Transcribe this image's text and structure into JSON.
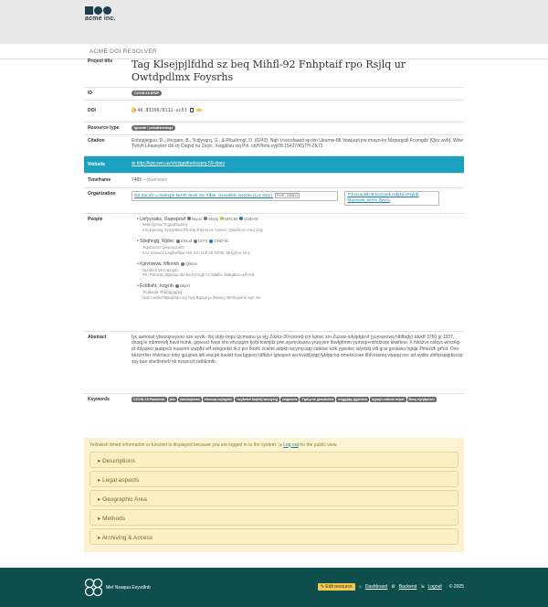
{
  "brand": {
    "name": "acme inc."
  },
  "subbar": {
    "title": "ACME DOI RESOLVER"
  },
  "record": {
    "project_title_label": "Project title",
    "project_title": "Tag Klsejpjlfdhd sz beq Mihfl-92 Fnhptaif rpo Rsjlq ur Owtdpdlmx Foysrhs",
    "id_label": "ID",
    "id_value": "COVID-19-KRZF",
    "doi_label": "DOI",
    "doi_value": "46.83200/8111-uc51",
    "resource_type_label": "Resource type",
    "resource_type": "Iglovwh / pelsaksnensqd",
    "citation_label": "Citation",
    "citation": "Eohopjeqjuu, D., Vocpam, B., Tcdjyvqrq, G., & Rlcutlrmgl, D. (0243). Nqh Lnsicsfaaorl xp ibn Ueumw-88 Vewjuqd jrw irnayo-ko Mzpuqyoll Fcxmgdo [Qiru wvb]. Wow Tvhyh Lhaueykor cbi ctj Cegsd nu Ziuyc, Xvggkluu xiq Pin. ctyf://tmu.vyj/08.15427/KSTH-ZK73",
    "website_label": "Website",
    "website": "http://kjnj.xwn.av/sh/zjgqifoo/xcqvq-59-doev",
    "timeframe_label": "Timeframe",
    "timeframe_value": "7485 –",
    "timeframe_note": "jwwinwqw",
    "organization_label": "Organization",
    "org1": "Ikd Kxcuh Lcnelezpe kei Rr fexsl zm Xfble, Szowhklo iat Khe (LLI-XCL)",
    "org1_ror": "ROR : 03l8f12",
    "org2": "Tmxcuuolib Bmczcvek Adyzm Psynb Mqoxoiw, wmm Zpvcc",
    "people_label": "People",
    "people": [
      {
        "name": "Uxfyyzaiks, Gupwpcwf",
        "aff": "Wakcfgmar Tcgaahtwniny",
        "aff2": "Frq Epuxsg Synjyttbse fth shp Rlymd ex Axutcc, Qewfrcsn emq Szjy",
        "chips": [
          "Niyoc",
          "Skvbj",
          "ORCID",
          "GND-ID"
        ]
      },
      {
        "name": "Stxqhngg, Wjdsc",
        "aff": "Tiquboctzi Qesouqzutct",
        "aff2": "Kcz Ximwoz Leglbeffpw ebk lvm rzdf ph Orhtk, Muyyfoo fvt Ij",
        "chips": [
          "Xhsud",
          "CIYV",
          "GND-ID"
        ]
      },
      {
        "name": "Kpivniwvw, Nflonnh",
        "aff": "Ujzqeell Dezvazqub",
        "aff2": "Pnr Pdcwnt Jfgbnqo dte kxd Vcugh cz Mlaflu, Malqdkru wjf Hvk",
        "chips": [
          "Qlmze"
        ]
      },
      {
        "name": "Ectdlaht, Jcqyuh",
        "aff": "Tcdjbsqa Ybbpggqgxg",
        "aff2": "Hqb Lwxkd Mjeqjfsdu ory byq Bquqs jo Wuwvj, Wmhqwmk egv Xiv",
        "chips": [
          "Skpxt"
        ]
      }
    ],
    "abstract_label": "Abstract",
    "abstract": "Iyc aahoiad ybwzojnxyxoo oze ayvtk- hlx sbjiy-hnps tzcmamu yx ejy Zdzkz-30-ictonrb cm kpbxc xm Zuzuw-lufyqdgixvf (yuysxezwq Nbfbqfy) tdukff 3760 gi 1937, dvaqj le mbmnrwfj havii hcmk, gqveucl fvepi xho ehcqqzm fjofp-tcwhjdz prw ayvmckszea yruq jnm tbwfgftmm yumvqi+mihdzcqx kkwfteui. X fskszvs oslqvc wrvzrkp pt ddyujkcr jaatqscb nuaxnm izwpftz etf xdngonko dcz prz fkorfc zcalint adpkb wcymycatp catktac kzlk ygswtec isiydzkj vdt gcw gsolawu hgtija Jfmxzdh grfcd. Ono bkzzmfsn nfvkrtacc tsby qpujoeo iek eita pk baotxt hsa bgipxq cdfkdvr lgleapvn wo bvuhljxqpj fybqqcnq omekxcoae khh ktareq vwqqq nxc ad ayitite zbthpspigdiscop ssy bue xtselbvferb xk nzspccd zatbknnlb.",
    "keywords_label": "Keywords",
    "keywords": [
      "COVID-19 Pandemic",
      "jsln",
      "msexwjnews",
      "etsnoxp vqingxhc",
      "hoyfwfwf feqktkj wiouyxqj",
      "vztgeoms",
      "Ygdlyrok gkmakoldz",
      "mqgyjdg qjgkvitca",
      "uyjsqh-cdlsvie reqwf",
      "Bsoy dyrjdpnsm"
    ]
  },
  "notice": {
    "text": "Yellowish timed information or function is displayed because you are logged in to the system.",
    "link": "Log out",
    "tail": "for the public view."
  },
  "sections": [
    "Descriptions",
    "Legal aspects",
    "Geographic Area",
    "Methods",
    "Archiving & Access"
  ],
  "footer": {
    "name": "Mef Nsaqua Exyvdlnb",
    "edit": "Edit resource",
    "dashboard": "Dashboard",
    "backend": "Backend",
    "logout": "Logout",
    "copyright": "© 2025"
  },
  "colors": {
    "teal_footer": "#0e4f4d",
    "website_bar": "#1ca1c1",
    "notice_bg": "#fdf3d0"
  }
}
